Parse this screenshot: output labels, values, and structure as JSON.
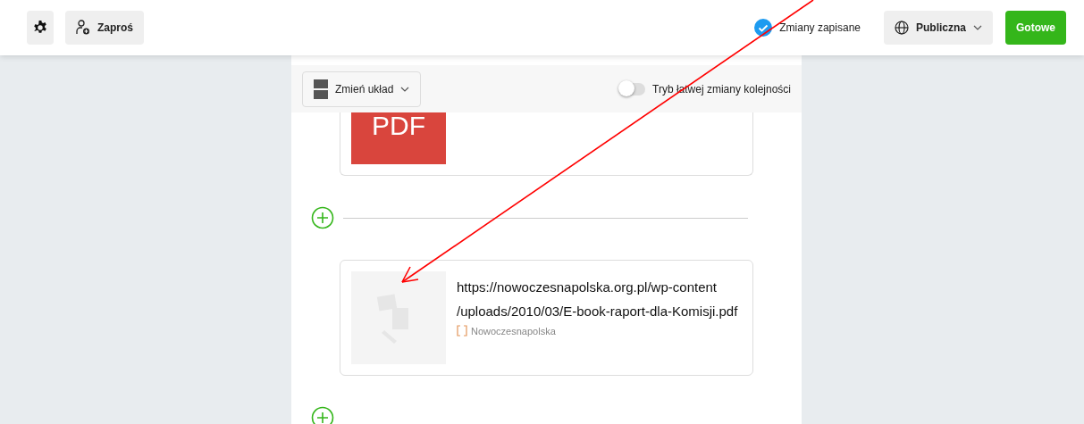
{
  "topbar": {
    "invite_button": "Zaproś",
    "save_status": "Zmiany zapisane",
    "visibility_button": "Publiczna",
    "done_button": "Gotowe"
  },
  "toolbar": {
    "layout_button": "Zmień układ",
    "reorder_toggle": {
      "label": "Tryb łatwej zmiany kolejności",
      "on": false
    }
  },
  "cards": [
    {
      "kind": "pdf",
      "thumbnail_text": "PDF"
    },
    {
      "kind": "link",
      "title": "https://nowoczesnapolska.org.pl/wp-content\n/uploads/2010/03/E-book-raport-dla-Komisji.pdf",
      "source": "Nowoczesnapolska"
    }
  ]
}
